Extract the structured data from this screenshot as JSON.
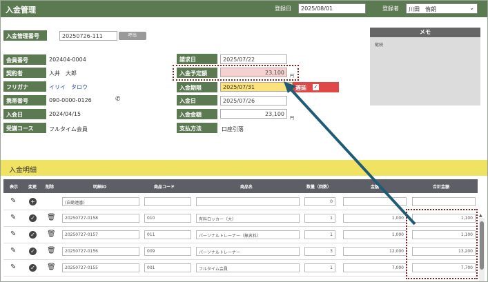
{
  "header": {
    "title": "入金管理",
    "registered_date_label": "登録日",
    "registered_date_value": "2025/08/01",
    "registrant_label": "登録者",
    "registrant_value": "川田　侑朗"
  },
  "top": {
    "payment_no_label": "入金管理番号",
    "payment_no_value": "20250726-111",
    "call_button": "呼出"
  },
  "left": {
    "member_no_label": "会員番号",
    "member_no": "202404-0004",
    "contractor_label": "契約者",
    "contractor": "入井　大郎",
    "kana_label": "フリガナ",
    "kana": "イリイ　タロウ",
    "mobile_label": "携帯番号",
    "mobile": "090-0000-0126",
    "join_label": "入会日",
    "join": "2024/04/15",
    "course_label": "受講コース",
    "course": "フルタイム会員"
  },
  "mid": {
    "invoice_date_label": "請求日",
    "invoice_date": "2025/07/22",
    "planned_amount_label": "入金予定額",
    "planned_amount": "23,100",
    "deadline_label": "入金期限",
    "deadline": "2025/07/31",
    "overdue_label": "遅延",
    "overdue_check": "✓",
    "paid_date_label": "入金日",
    "paid_date": "2025/07/26",
    "paid_amount_label": "入金金額",
    "paid_amount": "23,100",
    "method_label": "支払方法",
    "method": "口座引落",
    "unit": "円"
  },
  "memo": {
    "title": "メモ",
    "content": "継続"
  },
  "section": {
    "title": "入金明細"
  },
  "table": {
    "headers": [
      "表示",
      "変更",
      "削除",
      "明細ID",
      "商品コード",
      "商品名",
      "数量（回数）",
      "金額",
      "合計金額"
    ],
    "new_row": {
      "id": "(自動連番)",
      "qty": "0"
    },
    "rows": [
      {
        "id": "20250727-0158",
        "code": "010",
        "name": "有料ロッカー（大）",
        "qty": "1",
        "amount": "1,000",
        "total": "1,100"
      },
      {
        "id": "20250727-0157",
        "code": "011",
        "name": "パーソナルトレーナー（無名料）",
        "qty": "1",
        "amount": "1,000",
        "total": "1,100"
      },
      {
        "id": "20250727-0156",
        "code": "009",
        "name": "パーソナルトレーナー",
        "qty": "3",
        "amount": "12,000",
        "total": "13,200"
      },
      {
        "id": "20250727-0155",
        "code": "001",
        "name": "フルタイム会員",
        "qty": "1",
        "amount": "7,000",
        "total": "7,700"
      }
    ]
  },
  "colors": {
    "header_green": "#5c7a52",
    "section_yellow": "#f0e364",
    "overdue_red": "#e04747",
    "annotation_red": "#8b1a1a",
    "arrow_blue": "#1f5b75"
  }
}
